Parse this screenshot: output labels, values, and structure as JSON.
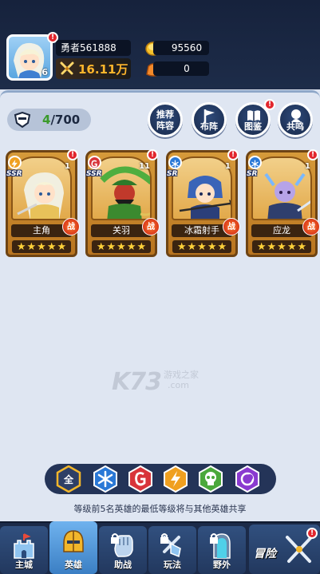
{
  "player": {
    "name": "勇者561888",
    "level": "6",
    "power": "16.11万"
  },
  "currency": {
    "gold": "95560",
    "gems": "0"
  },
  "hero_count": {
    "current": "4",
    "max": "/700"
  },
  "top_buttons": [
    {
      "label": "推荐\n阵容",
      "line1": "推荐",
      "line2": "阵容",
      "icon": "recommend"
    },
    {
      "label": "布阵",
      "icon": "flag-icon"
    },
    {
      "label": "图鉴",
      "icon": "book-icon"
    },
    {
      "label": "共鸣",
      "icon": "resonance-icon"
    }
  ],
  "heroes": [
    {
      "name": "主角",
      "rarity": "SSR",
      "level": "1",
      "element": "lightning",
      "element_color": "#f0a020",
      "stars": 5,
      "war": "战"
    },
    {
      "name": "关羽",
      "rarity": "SSR",
      "level": "11",
      "element": "fire",
      "element_color": "#d8343a",
      "stars": 5,
      "war": "战"
    },
    {
      "name": "冰霜射手",
      "rarity": "SR",
      "level": "1",
      "element": "ice",
      "element_color": "#2a78d6",
      "stars": 5,
      "war": "战"
    },
    {
      "name": "应龙",
      "rarity": "SR",
      "level": "1",
      "element": "ice",
      "element_color": "#2a78d6",
      "stars": 5,
      "war": "战"
    }
  ],
  "watermark": {
    "logo": "K73",
    "text1": "游戏之家",
    "text2": ".com"
  },
  "filters": {
    "all_label": "全",
    "items": [
      "all",
      "ice",
      "fire",
      "lightning",
      "poison",
      "light"
    ]
  },
  "notice": "等级前5名英雄的最低等级将与其他英雄共享",
  "nav": {
    "items": [
      {
        "label": "主城"
      },
      {
        "label": "英雄"
      },
      {
        "label": "助战"
      },
      {
        "label": "玩法"
      },
      {
        "label": "野外"
      }
    ],
    "adventure": "冒险"
  },
  "colors": {
    "header_bg": "#16223c",
    "panel_bg": "#dfe6f2",
    "card_gold": "#d69a3a",
    "accent_green": "#3a9a2b",
    "power_orange": "#ffb62c",
    "badge_red": "#e2262d"
  }
}
